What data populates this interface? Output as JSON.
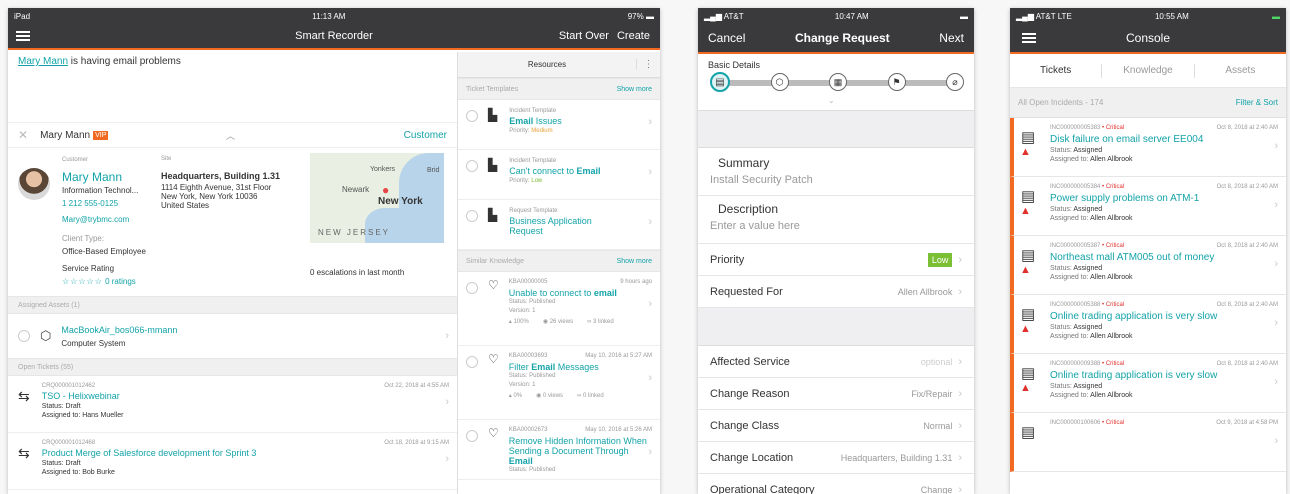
{
  "ipad": {
    "status": {
      "carrier": "iPad",
      "time": "11:13 AM",
      "battery": "97%"
    },
    "nav": {
      "title": "Smart Recorder",
      "start_over": "Start Over",
      "create": "Create"
    },
    "description": {
      "link_name": "Mary Mann",
      "text": " is having email problems"
    },
    "customer_bar": {
      "name": "Mary Mann",
      "vip": "VIP",
      "customer_label": "Customer"
    },
    "customer": {
      "label": "Customer",
      "name": "Mary Mann",
      "org": "Information Technol...",
      "phone": "1 212 555-0125",
      "email": "Mary@trybmc.com",
      "client_type_label": "Client Type:",
      "client_type": "Office-Based Employee",
      "service_rating_label": "Service Rating",
      "stars": "☆☆☆☆☆",
      "ratings": "0 ratings"
    },
    "site": {
      "label": "Site",
      "name": "Headquarters, Building 1.31",
      "addr1": "1114 Eighth Avenue, 31st Floor",
      "addr2": "New York, New York 10036",
      "addr3": "United States"
    },
    "map": {
      "l1": "Yonkers",
      "l2": "Newark",
      "l3": "New York",
      "l4": "NEW JERSEY",
      "l5": "Brid"
    },
    "escalations": "0 escalations in last month",
    "assets": {
      "header": "Assigned Assets (1)",
      "name": "MacBookAir_bos066-mmann",
      "type": "Computer System"
    },
    "tickets": {
      "header": "Open Tickets (55)",
      "items": [
        {
          "id": "CRQ000001012462",
          "title": "TSO - Helixwebinar",
          "status": "Status: Draft",
          "assigned": "Assigned to: Hans Mueller",
          "date": "Oct 22, 2018 at 4:55 AM"
        },
        {
          "id": "CRQ000001012468",
          "title": "Product Merge of Salesforce development for Sprint 3",
          "status": "Status: Draft",
          "assigned": "Assigned to: Bob Burke",
          "date": "Oct 18, 2018 at 9:15 AM"
        }
      ]
    },
    "resources": {
      "title": "Resources",
      "more": "⋮",
      "templates_header": "Ticket Templates",
      "show_more": "Show more",
      "templates": [
        {
          "kind": "Incident Template",
          "title_a": "Email",
          "title_b": " Issues",
          "priority_label": "Priority: ",
          "priority": "Medium",
          "pcolor": "#e8a13a"
        },
        {
          "kind": "Incident Template",
          "title_a": "Can't connect to ",
          "title_b": "Email",
          "priority_label": "Priority: ",
          "priority": "Low",
          "pcolor": "#7bbf35"
        },
        {
          "kind": "Request Template",
          "title_a": "Business Application",
          "title_b": "Request",
          "priority_label": "",
          "priority": "",
          "pcolor": "#999"
        }
      ],
      "knowledge_header": "Similar Knowledge",
      "knowledge_more": "Show more",
      "knowledge": [
        {
          "id": "KBA00000005",
          "date": "9 hours ago",
          "title_a": "Unable to connect to ",
          "title_b": "email",
          "status": "Status: Published",
          "version": "Version: 1",
          "m1": "100%",
          "m2": "26 views",
          "m3": "3 linked"
        },
        {
          "id": "KBA00003693",
          "date": "May 10, 2016 at 5:27 AM",
          "title_a": "Filter ",
          "title_b": "Email",
          "title_c": " Messages",
          "status": "Status: Published",
          "version": "Version: 1",
          "m1": "0%",
          "m2": "0 views",
          "m3": "0 linked"
        },
        {
          "id": "KBA00002673",
          "date": "May 10, 2016 at 5:26 AM",
          "title_a": "Remove Hidden Information When Sending a Document Through ",
          "title_b": "Email",
          "status": "Status: Published"
        }
      ]
    }
  },
  "phone1": {
    "status": {
      "carrier": "AT&T",
      "time": "10:47 AM"
    },
    "nav": {
      "cancel": "Cancel",
      "title": "Change Request",
      "next": "Next"
    },
    "basic_details": "Basic Details",
    "summary_label": "Summary",
    "summary_value": "Install Security Patch",
    "description_label": "Description",
    "description_placeholder": "Enter a value here",
    "fields": [
      {
        "label": "Priority",
        "value": "Low"
      },
      {
        "label": "Requested For",
        "value": "Allen Allbrook"
      }
    ],
    "fields2": [
      {
        "label": "Affected Service",
        "value": "optional"
      },
      {
        "label": "Change Reason",
        "value": "Fix/Repair"
      },
      {
        "label": "Change Class",
        "value": "Normal"
      },
      {
        "label": "Change Location",
        "value": "Headquarters, Building 1.31"
      },
      {
        "label": "Operational Category",
        "value": "Change"
      }
    ]
  },
  "phone2": {
    "status": {
      "carrier": "AT&T  LTE",
      "time": "10:55 AM"
    },
    "nav": {
      "title": "Console"
    },
    "tabs": [
      "Tickets",
      "Knowledge",
      "Assets"
    ],
    "filter_label": "All Open Incidents - 174",
    "filter_sort": "Filter & Sort",
    "incidents": [
      {
        "id": "INC000000005383",
        "sev": "Critical",
        "date": "Oct 8, 2018 at 2:40 AM",
        "title": "Disk failure on email server EE004",
        "status": "Assigned",
        "assigned": "Allen Allbrook"
      },
      {
        "id": "INC000000005384",
        "sev": "Critical",
        "date": "Oct 8, 2018 at 2:40 AM",
        "title": "Power supply problems on ATM-1",
        "status": "Assigned",
        "assigned": "Allen Allbrook"
      },
      {
        "id": "INC000000005387",
        "sev": "Critical",
        "date": "Oct 8, 2018 at 2:40 AM",
        "title": "Northeast mall ATM005 out of money",
        "status": "Assigned",
        "assigned": "Allen Allbrook"
      },
      {
        "id": "INC000000005388",
        "sev": "Critical",
        "date": "Oct 8, 2018 at 2:40 AM",
        "title": "Online trading application is very slow",
        "status": "Assigned",
        "assigned": "Allen Allbrook"
      },
      {
        "id": "INC000000009388",
        "sev": "Critical",
        "date": "Oct 8, 2018 at 2:40 AM",
        "title": "Online trading application is very slow",
        "status": "Assigned",
        "assigned": "Allen Allbrook"
      },
      {
        "id": "INC000000100606",
        "sev": "Critical",
        "date": "Oct 9, 2018 at 4:58 PM",
        "title": "",
        "status": "",
        "assigned": ""
      }
    ],
    "status_prefix": "Status: ",
    "assigned_prefix": "Assigned to: ",
    "sep": " • "
  },
  "colors": {
    "accent": "#f26a21",
    "teal": "#13a3a8",
    "nav": "#3a3a3c",
    "critical": "#e1312c"
  }
}
